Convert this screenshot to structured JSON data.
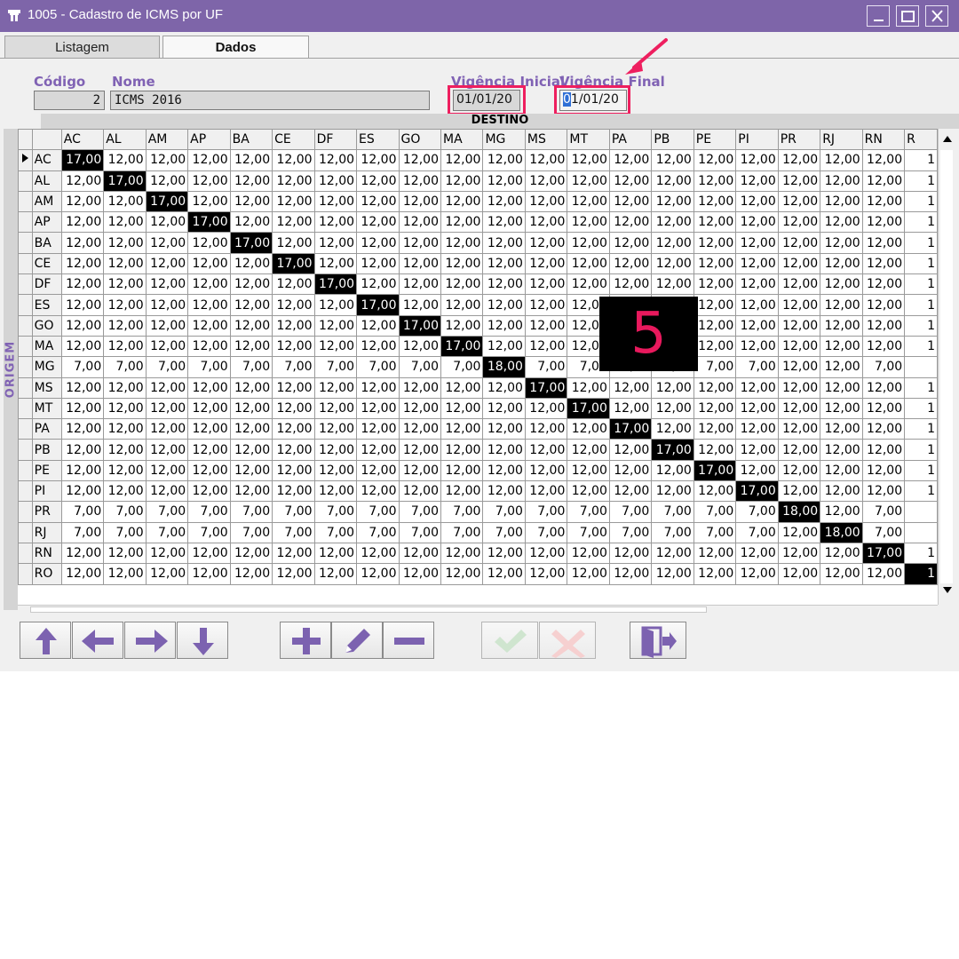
{
  "window": {
    "title": "1005 - Cadastro de ICMS por UF",
    "controls": [
      "minimize-icon",
      "maximize-icon",
      "close-icon"
    ]
  },
  "tabs": [
    {
      "label": "Listagem",
      "active": false
    },
    {
      "label": "Dados",
      "active": true
    }
  ],
  "form": {
    "codigo_label": "Código",
    "codigo_value": "2",
    "nome_label": "Nome",
    "nome_value": "ICMS 2016",
    "vigencia_inicial_label": "Vigência Inicial",
    "vigencia_inicial_value": "01/01/20",
    "vigencia_final_label": "Vigência Final",
    "vigencia_final_value_selected": "0",
    "vigencia_final_value_rest": "1/01/20"
  },
  "grid": {
    "destino_label": "DESTINO",
    "origem_label": "ORIGEM",
    "columns": [
      "AC",
      "AL",
      "AM",
      "AP",
      "BA",
      "CE",
      "DF",
      "ES",
      "GO",
      "MA",
      "MG",
      "MS",
      "MT",
      "PA",
      "PB",
      "PE",
      "PI",
      "PR",
      "RJ",
      "RN",
      "R"
    ],
    "rows": [
      {
        "uf": "AC",
        "cells": [
          "17,00",
          "12,00",
          "12,00",
          "12,00",
          "12,00",
          "12,00",
          "12,00",
          "12,00",
          "12,00",
          "12,00",
          "12,00",
          "12,00",
          "12,00",
          "12,00",
          "12,00",
          "12,00",
          "12,00",
          "12,00",
          "12,00",
          "12,00",
          "1"
        ]
      },
      {
        "uf": "AL",
        "cells": [
          "12,00",
          "17,00",
          "12,00",
          "12,00",
          "12,00",
          "12,00",
          "12,00",
          "12,00",
          "12,00",
          "12,00",
          "12,00",
          "12,00",
          "12,00",
          "12,00",
          "12,00",
          "12,00",
          "12,00",
          "12,00",
          "12,00",
          "12,00",
          "1"
        ]
      },
      {
        "uf": "AM",
        "cells": [
          "12,00",
          "12,00",
          "17,00",
          "12,00",
          "12,00",
          "12,00",
          "12,00",
          "12,00",
          "12,00",
          "12,00",
          "12,00",
          "12,00",
          "12,00",
          "12,00",
          "12,00",
          "12,00",
          "12,00",
          "12,00",
          "12,00",
          "12,00",
          "1"
        ]
      },
      {
        "uf": "AP",
        "cells": [
          "12,00",
          "12,00",
          "12,00",
          "17,00",
          "12,00",
          "12,00",
          "12,00",
          "12,00",
          "12,00",
          "12,00",
          "12,00",
          "12,00",
          "12,00",
          "12,00",
          "12,00",
          "12,00",
          "12,00",
          "12,00",
          "12,00",
          "12,00",
          "1"
        ]
      },
      {
        "uf": "BA",
        "cells": [
          "12,00",
          "12,00",
          "12,00",
          "12,00",
          "17,00",
          "12,00",
          "12,00",
          "12,00",
          "12,00",
          "12,00",
          "12,00",
          "12,00",
          "12,00",
          "12,00",
          "12,00",
          "12,00",
          "12,00",
          "12,00",
          "12,00",
          "12,00",
          "1"
        ]
      },
      {
        "uf": "CE",
        "cells": [
          "12,00",
          "12,00",
          "12,00",
          "12,00",
          "12,00",
          "17,00",
          "12,00",
          "12,00",
          "12,00",
          "12,00",
          "12,00",
          "12,00",
          "12,00",
          "12,00",
          "12,00",
          "12,00",
          "12,00",
          "12,00",
          "12,00",
          "12,00",
          "1"
        ]
      },
      {
        "uf": "DF",
        "cells": [
          "12,00",
          "12,00",
          "12,00",
          "12,00",
          "12,00",
          "12,00",
          "17,00",
          "12,00",
          "12,00",
          "12,00",
          "12,00",
          "12,00",
          "12,00",
          "12,00",
          "12,00",
          "12,00",
          "12,00",
          "12,00",
          "12,00",
          "12,00",
          "1"
        ]
      },
      {
        "uf": "ES",
        "cells": [
          "12,00",
          "12,00",
          "12,00",
          "12,00",
          "12,00",
          "12,00",
          "12,00",
          "17,00",
          "12,00",
          "12,00",
          "12,00",
          "12,00",
          "12,00",
          "12,00",
          "12,00",
          "12,00",
          "12,00",
          "12,00",
          "12,00",
          "12,00",
          "1"
        ]
      },
      {
        "uf": "GO",
        "cells": [
          "12,00",
          "12,00",
          "12,00",
          "12,00",
          "12,00",
          "12,00",
          "12,00",
          "12,00",
          "17,00",
          "12,00",
          "12,00",
          "12,00",
          "12,00",
          "12,00",
          "12,00",
          "12,00",
          "12,00",
          "12,00",
          "12,00",
          "12,00",
          "1"
        ]
      },
      {
        "uf": "MA",
        "cells": [
          "12,00",
          "12,00",
          "12,00",
          "12,00",
          "12,00",
          "12,00",
          "12,00",
          "12,00",
          "12,00",
          "17,00",
          "12,00",
          "12,00",
          "12,00",
          "12,00",
          "12,00",
          "12,00",
          "12,00",
          "12,00",
          "12,00",
          "12,00",
          "1"
        ]
      },
      {
        "uf": "MG",
        "cells": [
          "7,00",
          "7,00",
          "7,00",
          "7,00",
          "7,00",
          "7,00",
          "7,00",
          "7,00",
          "7,00",
          "7,00",
          "18,00",
          "7,00",
          "7,00",
          "7,00",
          "7,00",
          "7,00",
          "7,00",
          "12,00",
          "12,00",
          "7,00",
          ""
        ]
      },
      {
        "uf": "MS",
        "cells": [
          "12,00",
          "12,00",
          "12,00",
          "12,00",
          "12,00",
          "12,00",
          "12,00",
          "12,00",
          "12,00",
          "12,00",
          "12,00",
          "17,00",
          "12,00",
          "12,00",
          "12,00",
          "12,00",
          "12,00",
          "12,00",
          "12,00",
          "12,00",
          "1"
        ]
      },
      {
        "uf": "MT",
        "cells": [
          "12,00",
          "12,00",
          "12,00",
          "12,00",
          "12,00",
          "12,00",
          "12,00",
          "12,00",
          "12,00",
          "12,00",
          "12,00",
          "12,00",
          "17,00",
          "12,00",
          "12,00",
          "12,00",
          "12,00",
          "12,00",
          "12,00",
          "12,00",
          "1"
        ]
      },
      {
        "uf": "PA",
        "cells": [
          "12,00",
          "12,00",
          "12,00",
          "12,00",
          "12,00",
          "12,00",
          "12,00",
          "12,00",
          "12,00",
          "12,00",
          "12,00",
          "12,00",
          "12,00",
          "17,00",
          "12,00",
          "12,00",
          "12,00",
          "12,00",
          "12,00",
          "12,00",
          "1"
        ]
      },
      {
        "uf": "PB",
        "cells": [
          "12,00",
          "12,00",
          "12,00",
          "12,00",
          "12,00",
          "12,00",
          "12,00",
          "12,00",
          "12,00",
          "12,00",
          "12,00",
          "12,00",
          "12,00",
          "12,00",
          "17,00",
          "12,00",
          "12,00",
          "12,00",
          "12,00",
          "12,00",
          "1"
        ]
      },
      {
        "uf": "PE",
        "cells": [
          "12,00",
          "12,00",
          "12,00",
          "12,00",
          "12,00",
          "12,00",
          "12,00",
          "12,00",
          "12,00",
          "12,00",
          "12,00",
          "12,00",
          "12,00",
          "12,00",
          "12,00",
          "17,00",
          "12,00",
          "12,00",
          "12,00",
          "12,00",
          "1"
        ]
      },
      {
        "uf": "PI",
        "cells": [
          "12,00",
          "12,00",
          "12,00",
          "12,00",
          "12,00",
          "12,00",
          "12,00",
          "12,00",
          "12,00",
          "12,00",
          "12,00",
          "12,00",
          "12,00",
          "12,00",
          "12,00",
          "12,00",
          "17,00",
          "12,00",
          "12,00",
          "12,00",
          "1"
        ]
      },
      {
        "uf": "PR",
        "cells": [
          "7,00",
          "7,00",
          "7,00",
          "7,00",
          "7,00",
          "7,00",
          "7,00",
          "7,00",
          "7,00",
          "7,00",
          "7,00",
          "7,00",
          "7,00",
          "7,00",
          "7,00",
          "7,00",
          "7,00",
          "18,00",
          "12,00",
          "7,00",
          ""
        ]
      },
      {
        "uf": "RJ",
        "cells": [
          "7,00",
          "7,00",
          "7,00",
          "7,00",
          "7,00",
          "7,00",
          "7,00",
          "7,00",
          "7,00",
          "7,00",
          "7,00",
          "7,00",
          "7,00",
          "7,00",
          "7,00",
          "7,00",
          "7,00",
          "12,00",
          "18,00",
          "7,00",
          ""
        ]
      },
      {
        "uf": "RN",
        "cells": [
          "12,00",
          "12,00",
          "12,00",
          "12,00",
          "12,00",
          "12,00",
          "12,00",
          "12,00",
          "12,00",
          "12,00",
          "12,00",
          "12,00",
          "12,00",
          "12,00",
          "12,00",
          "12,00",
          "12,00",
          "12,00",
          "12,00",
          "17,00",
          "1"
        ]
      },
      {
        "uf": "RO",
        "cells": [
          "12,00",
          "12,00",
          "12,00",
          "12,00",
          "12,00",
          "12,00",
          "12,00",
          "12,00",
          "12,00",
          "12,00",
          "12,00",
          "12,00",
          "12,00",
          "12,00",
          "12,00",
          "12,00",
          "12,00",
          "12,00",
          "12,00",
          "12,00",
          "1"
        ]
      }
    ],
    "diagonal_cells": [
      [
        0,
        0
      ],
      [
        1,
        1
      ],
      [
        2,
        2
      ],
      [
        3,
        3
      ],
      [
        4,
        4
      ],
      [
        5,
        5
      ],
      [
        6,
        6
      ],
      [
        7,
        7
      ],
      [
        8,
        8
      ],
      [
        9,
        9
      ],
      [
        10,
        10
      ],
      [
        11,
        11
      ],
      [
        12,
        12
      ],
      [
        13,
        13
      ],
      [
        14,
        14
      ],
      [
        15,
        15
      ],
      [
        16,
        16
      ],
      [
        17,
        17
      ],
      [
        18,
        18
      ],
      [
        19,
        19
      ],
      [
        20,
        20
      ]
    ]
  },
  "overlay": {
    "step_number": "5",
    "color": "#e8195d"
  },
  "toolbar": {
    "buttons": [
      {
        "name": "move-up-button",
        "icon": "arrow-up-icon",
        "enabled": true
      },
      {
        "name": "move-left-button",
        "icon": "arrow-left-icon",
        "enabled": true
      },
      {
        "name": "move-right-button",
        "icon": "arrow-right-icon",
        "enabled": true
      },
      {
        "name": "move-down-button",
        "icon": "arrow-down-icon",
        "enabled": true
      },
      {
        "name": "add-button",
        "icon": "plus-icon",
        "enabled": true
      },
      {
        "name": "edit-button",
        "icon": "pencil-icon",
        "enabled": true
      },
      {
        "name": "delete-button",
        "icon": "minus-icon",
        "enabled": true
      },
      {
        "name": "confirm-button",
        "icon": "check-icon",
        "enabled": false
      },
      {
        "name": "cancel-button",
        "icon": "x-icon",
        "enabled": false
      },
      {
        "name": "exit-button",
        "icon": "exit-door-icon",
        "enabled": true
      }
    ]
  },
  "colors": {
    "titlebar": "#7e65a9",
    "label_purple": "#8062b4",
    "highlight_pink": "#ee1f5f",
    "icon_purple": "#7c62b0"
  }
}
